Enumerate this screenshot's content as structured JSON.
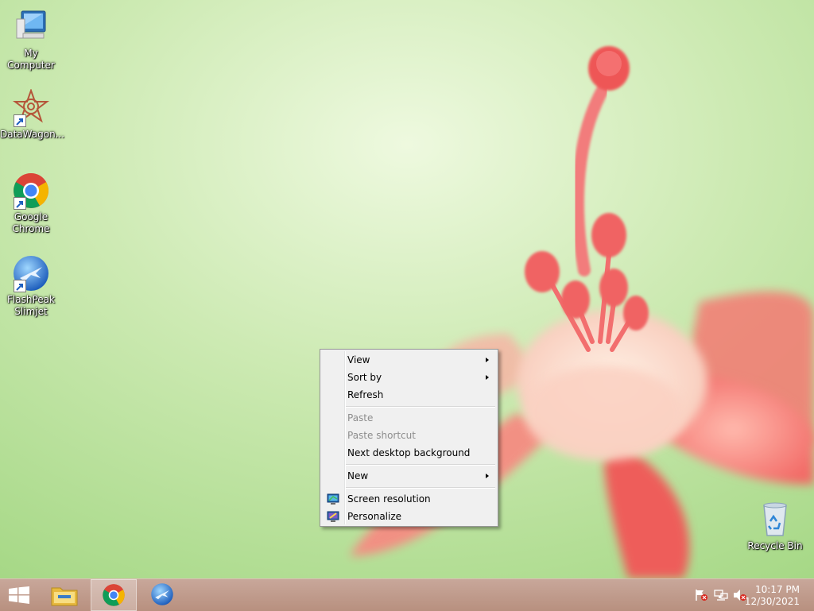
{
  "desktop": {
    "icons": [
      {
        "label": "My Computer",
        "icon": "computer-icon"
      },
      {
        "label": "DataWagon...",
        "icon": "datawagon-icon"
      },
      {
        "label": "Google Chrome",
        "icon": "chrome-icon"
      },
      {
        "label": "FlashPeak Slimjet",
        "icon": "slimjet-icon"
      },
      {
        "label": "Recycle Bin",
        "icon": "recycle-bin-icon"
      }
    ]
  },
  "context_menu": {
    "items": [
      {
        "label": "View",
        "has_submenu": true,
        "enabled": true
      },
      {
        "label": "Sort by",
        "has_submenu": true,
        "enabled": true
      },
      {
        "label": "Refresh",
        "enabled": true
      },
      {
        "label": "Paste",
        "enabled": false
      },
      {
        "label": "Paste shortcut",
        "enabled": false
      },
      {
        "label": "Next desktop background",
        "enabled": true
      },
      {
        "label": "New",
        "has_submenu": true,
        "enabled": true
      },
      {
        "label": "Screen resolution",
        "icon": "display-icon",
        "enabled": true
      },
      {
        "label": "Personalize",
        "icon": "personalize-icon",
        "enabled": true
      }
    ]
  },
  "taskbar": {
    "buttons": [
      {
        "name": "start",
        "icon": "windows-logo-icon"
      },
      {
        "name": "file-explorer",
        "icon": "folder-icon"
      },
      {
        "name": "google-chrome",
        "icon": "chrome-icon",
        "active": true
      },
      {
        "name": "slimjet",
        "icon": "slimjet-icon"
      }
    ],
    "tray": {
      "icons": [
        "action-center-flag-icon",
        "network-icon",
        "volume-muted-icon"
      ],
      "time": "10:17 PM",
      "date": "12/30/2021"
    }
  },
  "colors": {
    "wallpaper_green": "#b9e39a",
    "flower_red": "#f05a5a",
    "taskbar": "#c29e8f",
    "menu_bg": "#f0f0f0"
  }
}
